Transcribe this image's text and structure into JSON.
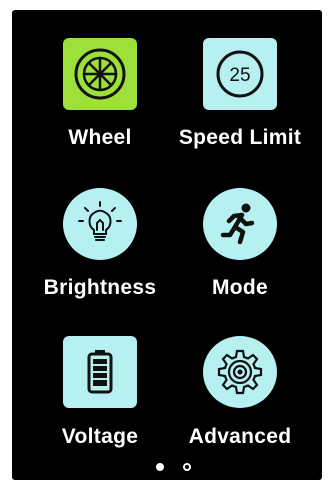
{
  "colors": {
    "background": "#000000",
    "tile": "#b7f0f0",
    "tile_selected": "#9ee03a",
    "icon_stroke": "#111111",
    "label": "#ffffff"
  },
  "menu": {
    "items": [
      {
        "label": "Wheel",
        "icon": "wheel-icon",
        "selected": true
      },
      {
        "label": "Speed Limit",
        "icon": "speed-limit-icon",
        "value": "25"
      },
      {
        "label": "Brightness",
        "icon": "lightbulb-icon"
      },
      {
        "label": "Mode",
        "icon": "running-person-icon"
      },
      {
        "label": "Voltage",
        "icon": "battery-icon"
      },
      {
        "label": "Advanced",
        "icon": "gear-icon"
      }
    ]
  },
  "pagination": {
    "current_page": 1,
    "total_pages": 2
  }
}
